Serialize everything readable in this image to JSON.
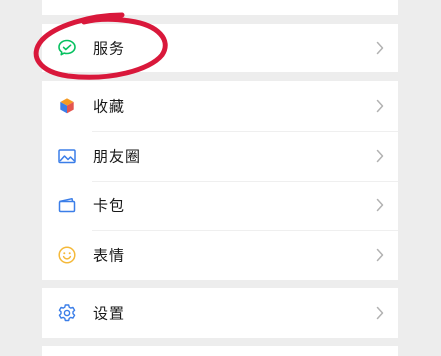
{
  "menu": {
    "service": {
      "label": "服务",
      "icon": "wechat-pay-icon"
    },
    "items": [
      {
        "label": "收藏",
        "icon": "favorites-cube-icon"
      },
      {
        "label": "朋友圈",
        "icon": "moments-picture-icon"
      },
      {
        "label": "卡包",
        "icon": "card-wallet-icon"
      },
      {
        "label": "表情",
        "icon": "smiley-face-icon"
      }
    ],
    "settings": {
      "label": "设置",
      "icon": "gear-icon"
    }
  },
  "colors": {
    "background": "#ededed",
    "card": "#ffffff",
    "text": "#191919",
    "chevron": "#b2b2b2",
    "service_green": "#07c160",
    "favorites_orange": "#f59a23",
    "favorites_blue": "#3b7ee8",
    "favorites_red": "#e5554f",
    "moments_blue": "#3b7ee8",
    "card_blue": "#3b7ee8",
    "sticker_yellow": "#f5b93a",
    "settings_blue": "#3b7ee8",
    "annotation_red": "#d9183b"
  }
}
